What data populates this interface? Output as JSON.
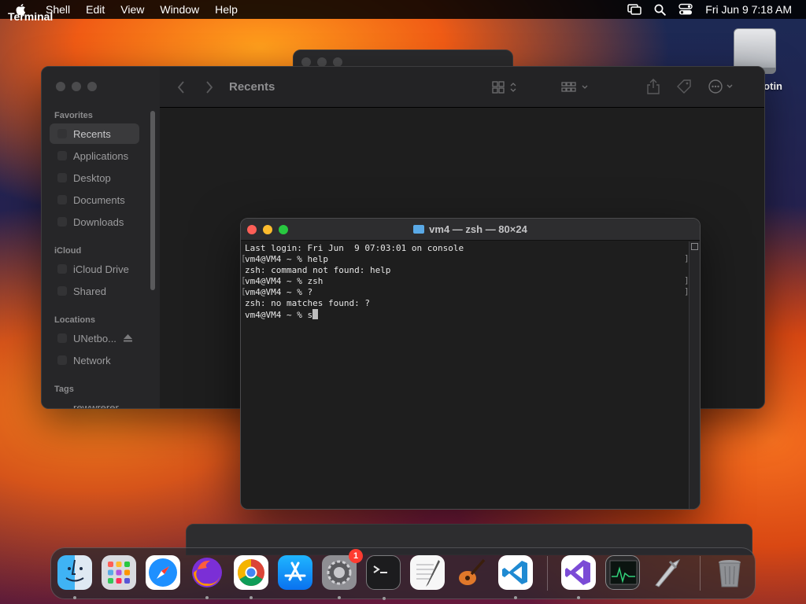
{
  "menubar": {
    "app_name": "Terminal",
    "items": [
      "Shell",
      "Edit",
      "View",
      "Window",
      "Help"
    ],
    "clock": "Fri Jun 9  7:18 AM"
  },
  "desktop": {
    "drive_label": "otin"
  },
  "finder": {
    "title": "Recents",
    "sections": {
      "favorites": "Favorites",
      "icloud": "iCloud",
      "locations": "Locations",
      "tags": "Tags"
    },
    "favorites": [
      "Recents",
      "Applications",
      "Desktop",
      "Documents",
      "Downloads"
    ],
    "icloud": [
      "iCloud Drive",
      "Shared"
    ],
    "locations": [
      "UNetbo...",
      "Network"
    ],
    "tags": [
      "rewwrerer"
    ]
  },
  "terminal": {
    "title": "vm4 — zsh — 80×24",
    "lines": [
      "Last login: Fri Jun  9 07:03:01 on console",
      "vm4@VM4 ~ % help",
      "zsh: command not found: help",
      "vm4@VM4 ~ % zsh",
      "vm4@VM4 ~ % ?",
      "zsh: no matches found: ?",
      "vm4@VM4 ~ % s"
    ]
  },
  "dock": {
    "apps": [
      "Finder",
      "Launchpad",
      "Safari",
      "Firefox",
      "Chrome",
      "App Store",
      "System Settings",
      "Terminal",
      "TextEdit",
      "GarageBand",
      "VS Code",
      "Visual Studio",
      "Activity Monitor",
      "Xcode",
      "Trash"
    ],
    "settings_badge": "1"
  },
  "colors": {
    "accent_red": "#fe5f57",
    "accent_yellow": "#febc2e",
    "accent_green": "#28c840",
    "badge": "#ff3b30"
  }
}
